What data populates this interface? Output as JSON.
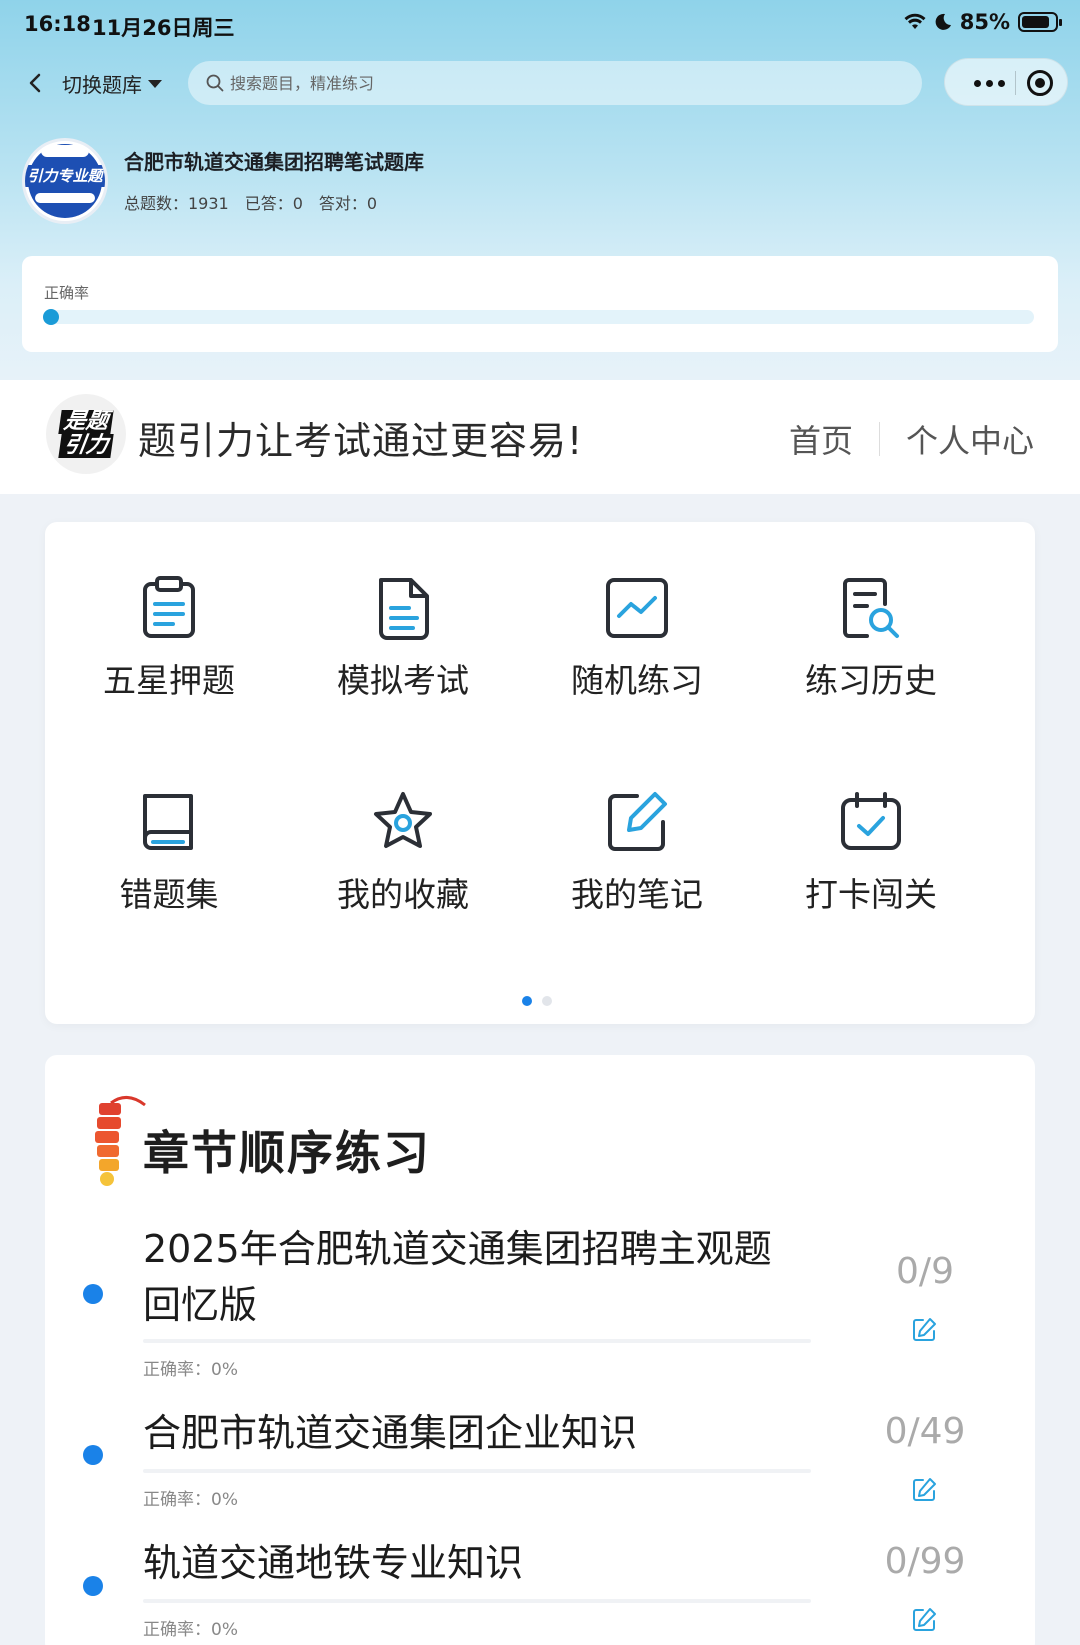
{
  "status_bar": {
    "time": "16:18",
    "date": "11月26日周三",
    "battery": "85%",
    "battery_level": 0.85
  },
  "nav": {
    "switch_label": "切换题库",
    "search_placeholder": "搜索题目，精准练习"
  },
  "bank": {
    "title": "合肥市轨道交通集团招聘笔试题库",
    "logo_text": "引力专业题",
    "stats": {
      "total": "总题数：1931",
      "answered": "已答：0",
      "correct": "答对：0"
    }
  },
  "accuracy": {
    "label": "正确率",
    "value": 0
  },
  "banner": {
    "logo_line1": "是题",
    "logo_line2": "引力",
    "slogan": "题引力让考试通过更容易!",
    "nav_home": "首页",
    "nav_profile": "个人中心"
  },
  "grid": {
    "items": [
      {
        "label": "五星押题",
        "icon": "clipboard-icon"
      },
      {
        "label": "模拟考试",
        "icon": "document-icon"
      },
      {
        "label": "随机练习",
        "icon": "chart-icon"
      },
      {
        "label": "练习历史",
        "icon": "history-search-icon"
      },
      {
        "label": "错题集",
        "icon": "book-icon"
      },
      {
        "label": "我的收藏",
        "icon": "star-icon"
      },
      {
        "label": "我的笔记",
        "icon": "note-edit-icon"
      },
      {
        "label": "打卡闯关",
        "icon": "calendar-check-icon"
      }
    ],
    "page_dots": 2,
    "active_page": 1
  },
  "chapters": {
    "title": "章节顺序练习",
    "items": [
      {
        "name": "2025年合肥轨道交通集团招聘主观题回忆版",
        "progress": "0/9",
        "accuracy": "正确率：0%"
      },
      {
        "name": "合肥市轨道交通集团企业知识",
        "progress": "0/49",
        "accuracy": "正确率：0%"
      },
      {
        "name": "轨道交通地铁专业知识",
        "progress": "0/99",
        "accuracy": "正确率：0%"
      }
    ]
  },
  "colors": {
    "accent": "#1a82e8",
    "hero_top": "#8fd3ea",
    "icon_blue": "#2aa3de",
    "icon_dark": "#2b2f36"
  }
}
